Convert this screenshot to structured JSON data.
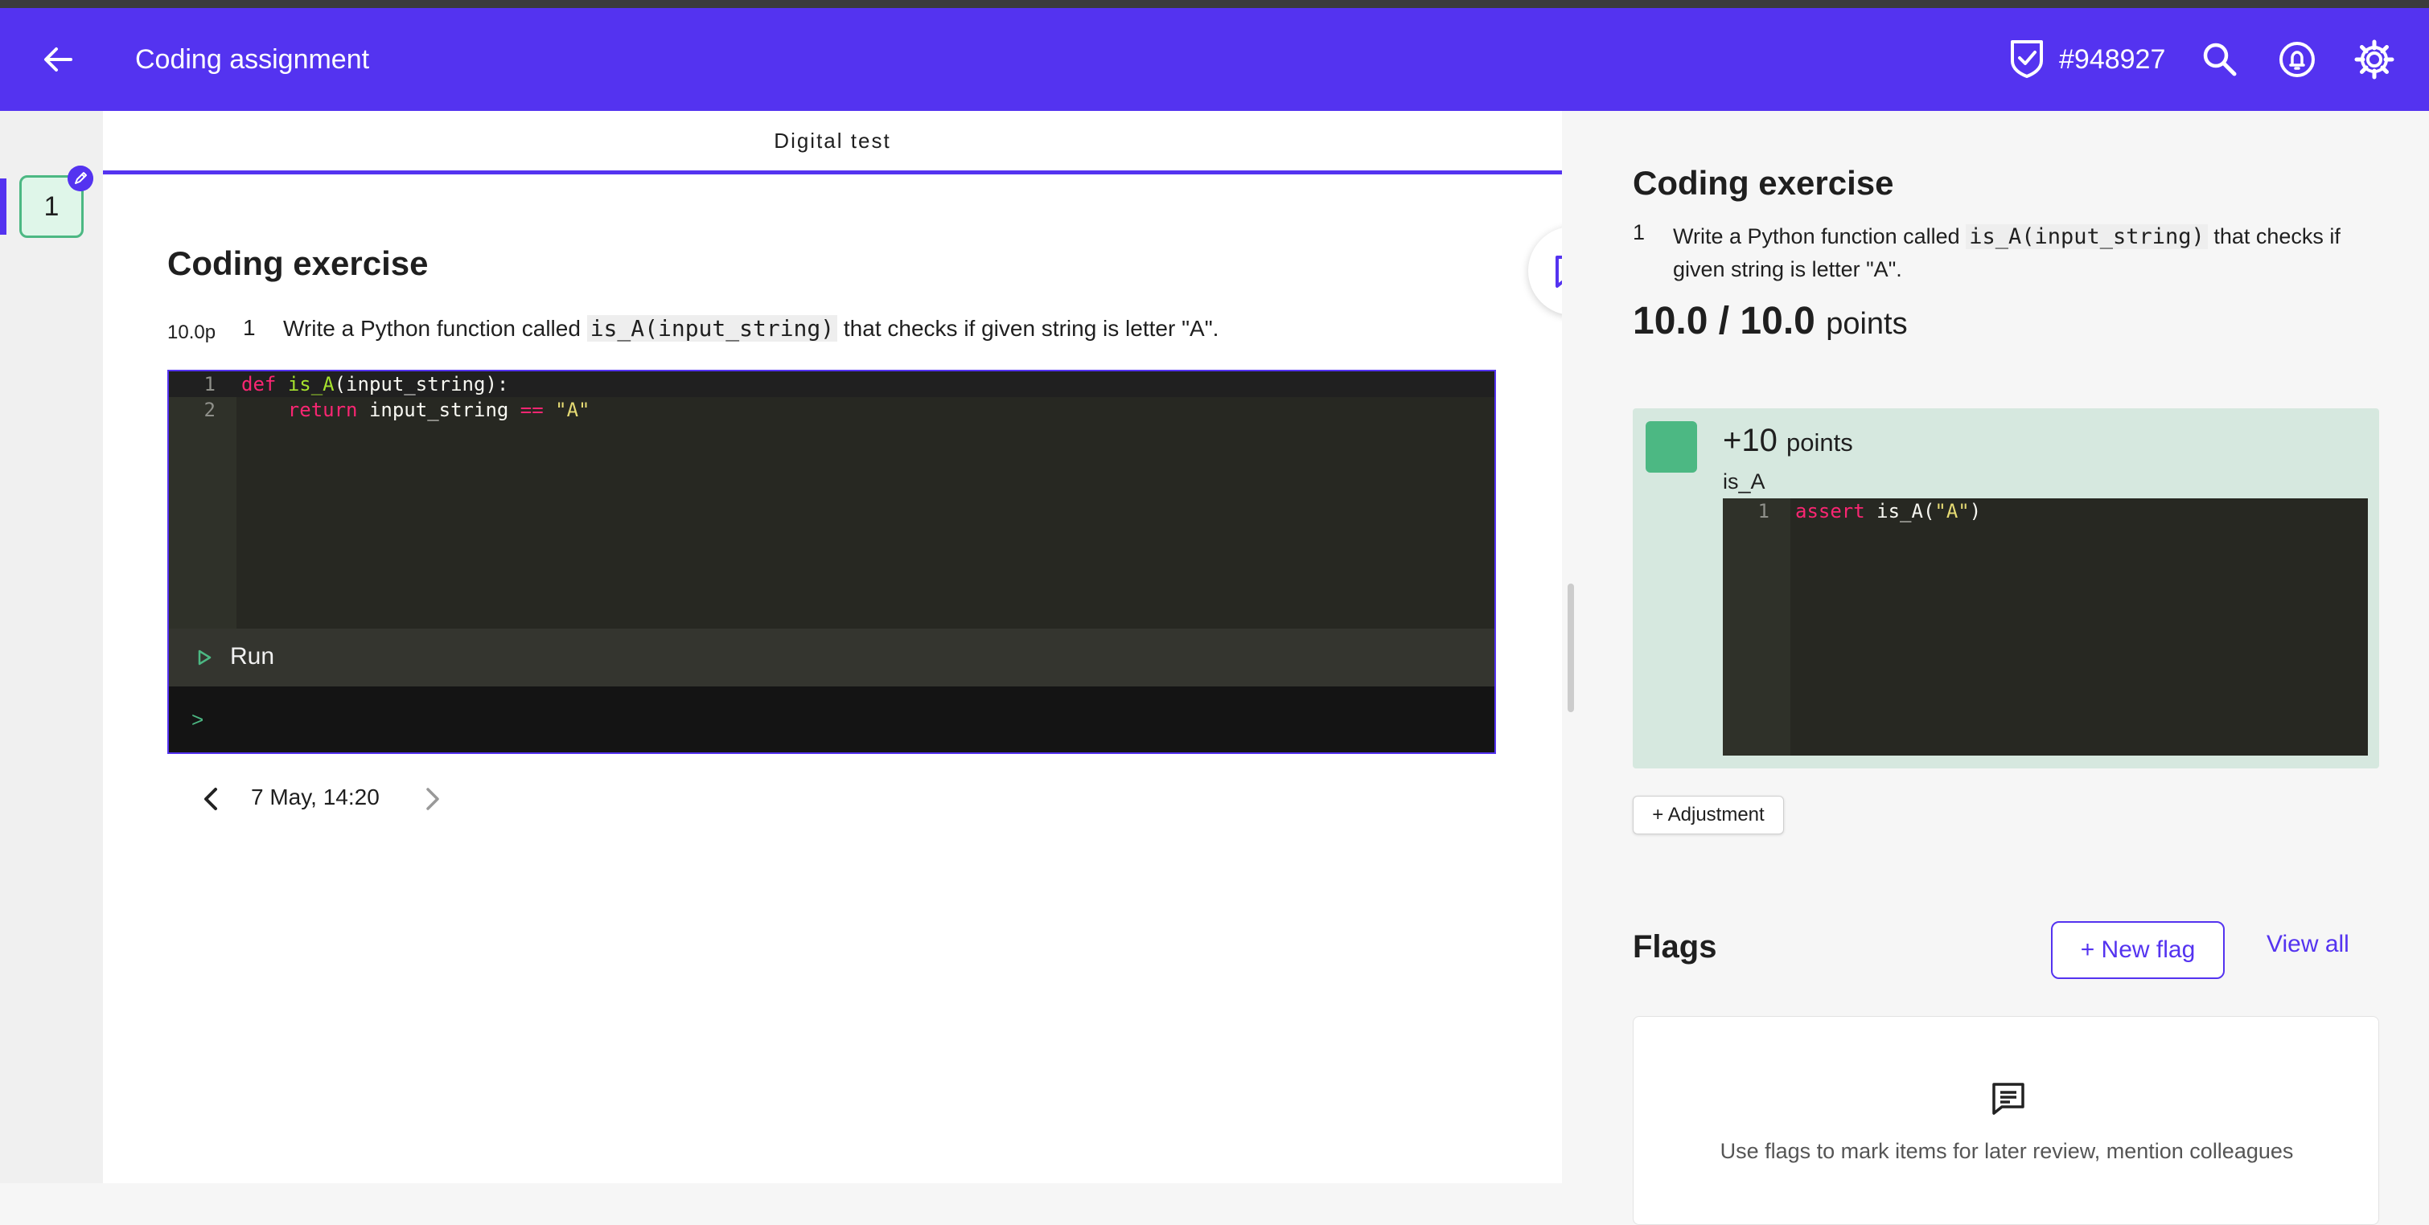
{
  "appbar": {
    "title": "Coding assignment",
    "id_code": "#948927",
    "color": "#5433f0"
  },
  "rail": {
    "question_number": "1"
  },
  "main": {
    "tab_title": "Digital test",
    "exercise_title": "Coding exercise",
    "points": "10.0p",
    "question_number": "1",
    "question_prefix": "Write a Python function called",
    "question_code": "is_A(input_string)",
    "question_suffix": "that checks if given string is letter \"A\".",
    "code_lines": [
      {
        "n": "1",
        "kw": "def",
        "fn": "is_A",
        "rest": "(input_string):"
      },
      {
        "n": "2",
        "kw": "return",
        "rest": " input_string ",
        "op": "==",
        "str": "\"A\""
      }
    ],
    "run_label": "Run",
    "console_prompt": ">",
    "timestamp": "7 May, 14:20"
  },
  "review": {
    "exercise_title": "Coding exercise",
    "question_number": "1",
    "question_prefix": "Write a Python function called",
    "question_code": "is_A(input_string)",
    "question_suffix": "that checks if given string is letter \"A\".",
    "score": "10.0 / 10.0",
    "score_unit": "points",
    "test": {
      "points": "+10",
      "points_unit": "points",
      "name": "is_A",
      "line_number": "1",
      "code_kw": "assert",
      "code_rest_pre": " is_A(",
      "code_str": "\"A\"",
      "code_rest_post": ")"
    },
    "adjustment_label": "+ Adjustment",
    "flags_title": "Flags",
    "new_flag_label": "+ New flag",
    "view_all_label": "View all",
    "flags_hint": "Use flags to mark items for later review, mention colleagues"
  },
  "icons": {
    "back": "arrow-left-icon",
    "badge": "shield-check-icon",
    "search": "search-icon",
    "notifications": "bell-circle-icon",
    "settings": "gear-icon",
    "edit": "pencil-icon",
    "feedback": "feedback-icon",
    "play": "play-icon",
    "prev": "chevron-left-icon",
    "next": "chevron-right-icon",
    "comment": "comment-icon"
  }
}
